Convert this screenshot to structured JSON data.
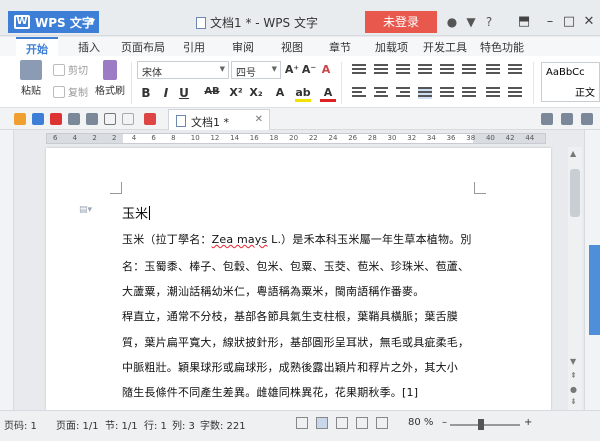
{
  "titlebar": {
    "app_name": "WPS 文字",
    "doc_title": "文档1 * - WPS 文字",
    "login": "未登录"
  },
  "menu": [
    "开始",
    "插入",
    "页面布局",
    "引用",
    "审阅",
    "视图",
    "章节",
    "加载项",
    "开发工具",
    "特色功能"
  ],
  "ribbon": {
    "paste": "粘贴",
    "cut": "剪切",
    "copy": "复制",
    "format_painter": "格式刷",
    "font_name": "宋体",
    "font_size": "四号",
    "style_preview": "AaBbCc",
    "style_name": "正文"
  },
  "doc_tab": "文档1 *",
  "ruler_numbers": [
    "6",
    "4",
    "2",
    "2",
    "4",
    "6",
    "8",
    "10",
    "12",
    "14",
    "16",
    "18",
    "20",
    "22",
    "24",
    "26",
    "28",
    "30",
    "32",
    "34",
    "36",
    "38",
    "40",
    "42",
    "44"
  ],
  "document": {
    "heading": "玉米",
    "lines": [
      {
        "pre": "玉米（拉丁學名：",
        "latin": "Zea mays",
        "post": " L.）是禾本科玉米屬一年生草本植物。別"
      },
      {
        "text": "名：玉蜀黍、棒子、包穀、包米、包粟、玉茭、苞米、珍珠米、苞蘆、"
      },
      {
        "text": "大蘆粟，潮汕話稱幼米仁，粵語稱為粟米，閩南語稱作番麥。"
      },
      {
        "text": "稈直立，通常不分枝，基部各節具氣生支柱根，葉鞘具橫脈；葉舌膜"
      },
      {
        "text": "質，葉片扁平寬大，線狀披針形，基部圓形呈耳狀，無毛或具疵柔毛，"
      },
      {
        "text": "中脈粗壯。穎果球形或扁球形，成熟後露出穎片和稃片之外，其大小"
      },
      {
        "text": "隨生長條件不同產生差異。雌雄同株異花，花果期秋季。[1]"
      }
    ]
  },
  "status": {
    "page_no": "页码: 1",
    "pages": "页面: 1/1",
    "section": "节: 1/1",
    "row": "行: 1",
    "col": "列: 3",
    "words": "字数: 221",
    "zoom": "80 %"
  }
}
